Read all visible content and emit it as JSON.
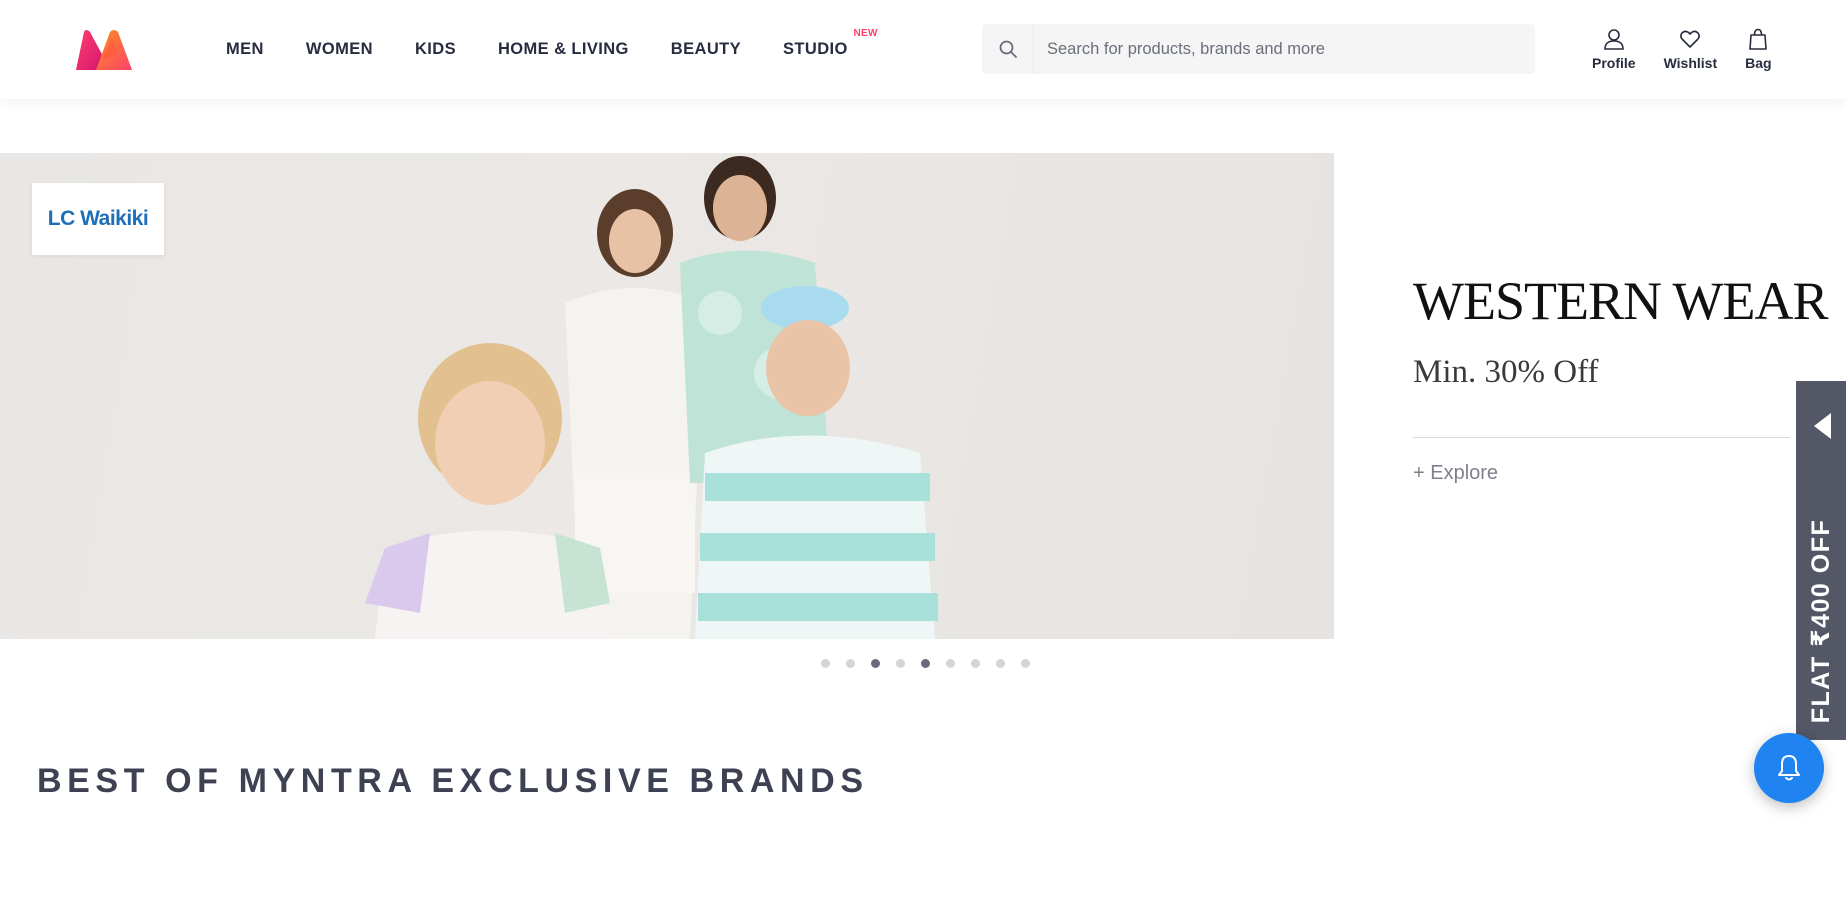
{
  "header": {
    "nav": [
      {
        "label": "MEN"
      },
      {
        "label": "WOMEN"
      },
      {
        "label": "KIDS"
      },
      {
        "label": "HOME & LIVING"
      },
      {
        "label": "BEAUTY"
      },
      {
        "label": "STUDIO",
        "badge": "NEW"
      }
    ],
    "search": {
      "placeholder": "Search for products, brands and more",
      "value": ""
    },
    "actions": {
      "profile": "Profile",
      "wishlist": "Wishlist",
      "bag": "Bag"
    }
  },
  "hero": {
    "brand": "LC Waikiki",
    "title": "WESTERN WEAR",
    "subtitle": "Min. 30% Off",
    "link": "+ Explore",
    "slides_total": 9,
    "active_dots": [
      3,
      5
    ]
  },
  "section": {
    "title": "BEST OF MYNTRA EXCLUSIVE BRANDS"
  },
  "side_tab": {
    "label": "FLAT ₹400 OFF"
  },
  "colors": {
    "brand_pink": "#ff3f6c",
    "accent_blue": "#1f83f2",
    "side_tab": "#535766"
  }
}
